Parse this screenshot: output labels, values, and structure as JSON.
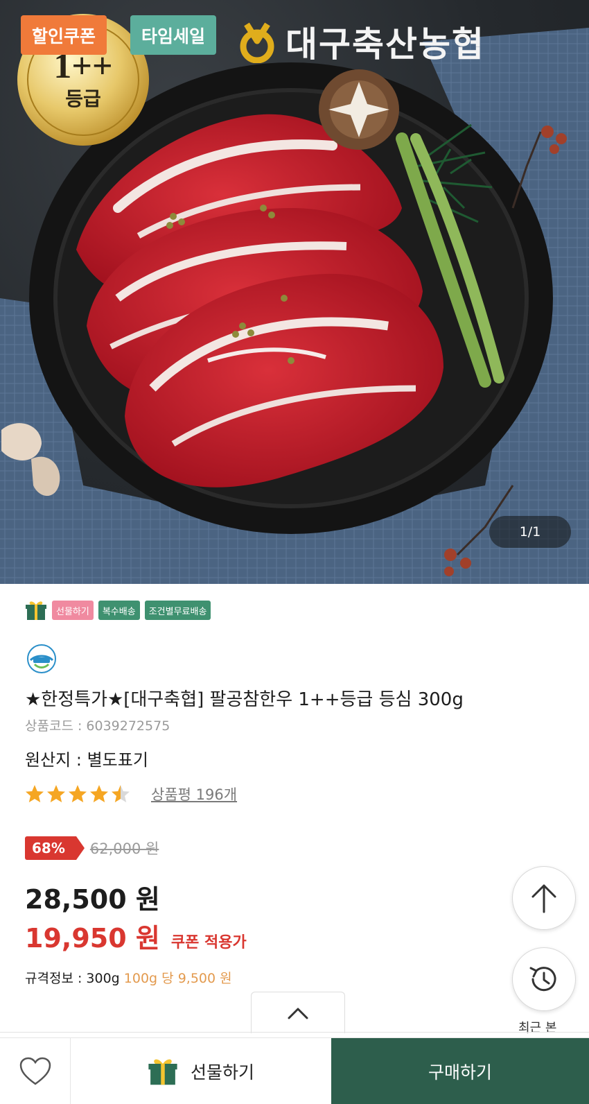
{
  "hero": {
    "tags": {
      "coupon": "할인쿠폰",
      "timesale": "타임세일"
    },
    "brand": "대구축산농협",
    "grade_seal": {
      "grade": "1++",
      "label": "등급"
    },
    "pager": "1/1"
  },
  "badges": {
    "gift": "선물하기",
    "multi_ship": "복수배송",
    "free_ship": "조건별무료배송"
  },
  "product": {
    "title": "★한정특가★[대구축협] 팔공참한우 1++등급 등심 300g",
    "code": "상품코드 : 6039272575",
    "origin": "원산지 : 별도표기",
    "rating": 4.5,
    "review_text": "상품평 196개"
  },
  "price": {
    "discount": "68%",
    "original": "62,000 원",
    "sale": "28,500 원",
    "coupon_price": "19,950 원",
    "coupon_label": "쿠폰 적용가",
    "spec_label": "규격정보 : 300g",
    "unit_label": "100g 당",
    "unit_price": "9,500 원"
  },
  "floating": {
    "recent_label": "최근 본"
  },
  "bottom_bar": {
    "gift_label": "선물하기",
    "buy_label": "구매하기"
  },
  "colors": {
    "accent_green": "#2d5e4c",
    "sale_red": "#d93730",
    "coupon_orange": "#f07a3a",
    "timesale_teal": "#5cae9c"
  },
  "icons": [
    "gift-icon",
    "haccp-icon",
    "star-icon",
    "arrow-up-icon",
    "history-icon",
    "chevron-up-icon",
    "heart-icon"
  ]
}
